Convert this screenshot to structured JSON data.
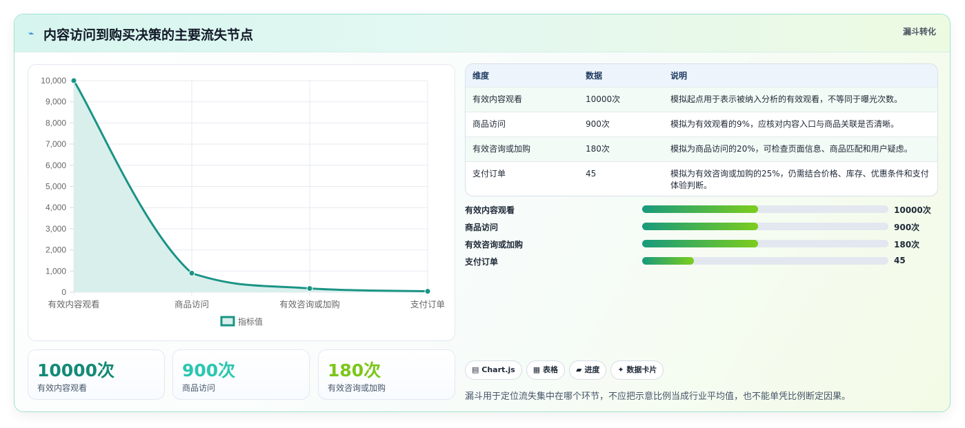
{
  "header": {
    "icon": "⌁",
    "title": "内容访问到购买决策的主要流失节点",
    "tag": "漏斗转化"
  },
  "chart_data": {
    "type": "area",
    "categories": [
      "有效内容观看",
      "商品访问",
      "有效咨询或加购",
      "支付订单"
    ],
    "series": [
      {
        "name": "指标值",
        "values": [
          10000,
          900,
          180,
          45
        ]
      }
    ],
    "ylim": [
      0,
      10000
    ],
    "yticks": [
      "0",
      "1,000",
      "2,000",
      "3,000",
      "4,000",
      "5,000",
      "6,000",
      "7,000",
      "8,000",
      "9,000",
      "10,000"
    ],
    "legend": "bottom",
    "grid": true,
    "colors": {
      "line": "#1a9485",
      "fill": "#d9efec"
    }
  },
  "stats": [
    {
      "value": "10000次",
      "label": "有效内容观看",
      "color": "#138a76"
    },
    {
      "value": "900次",
      "label": "商品访问",
      "color": "#2bc6b0"
    },
    {
      "value": "180次",
      "label": "有效咨询或加购",
      "color": "#7cc61a"
    }
  ],
  "table": {
    "headers": [
      "维度",
      "数据",
      "说明"
    ],
    "rows": [
      {
        "dim": "有效内容观看",
        "val": "10000次",
        "desc": "模拟起点用于表示被纳入分析的有效观看，不等同于曝光次数。"
      },
      {
        "dim": "商品访问",
        "val": "900次",
        "desc": "模拟为有效观看的9%，应核对内容入口与商品关联是否清晰。"
      },
      {
        "dim": "有效咨询或加购",
        "val": "180次",
        "desc": "模拟为商品访问的20%，可检查页面信息、商品匹配和用户疑虑。"
      },
      {
        "dim": "支付订单",
        "val": "45",
        "desc": "模拟为有效咨询或加购的25%，仍需结合价格、库存、优惠条件和支付体验判断。"
      }
    ]
  },
  "bars": [
    {
      "label": "有效内容观看",
      "value": "10000次",
      "fill": 0.47
    },
    {
      "label": "商品访问",
      "value": "900次",
      "fill": 0.47
    },
    {
      "label": "有效咨询或加购",
      "value": "180次",
      "fill": 0.47
    },
    {
      "label": "支付订单",
      "value": "45",
      "fill": 0.21
    }
  ],
  "chips": [
    {
      "icon": "▤",
      "label": "Chart.js"
    },
    {
      "icon": "▦",
      "label": "表格"
    },
    {
      "icon": "▰",
      "label": "进度"
    },
    {
      "icon": "✦",
      "label": "数据卡片"
    }
  ],
  "note": "漏斗用于定位流失集中在哪个环节，不应把示意比例当成行业平均值，也不能单凭比例断定因果。"
}
